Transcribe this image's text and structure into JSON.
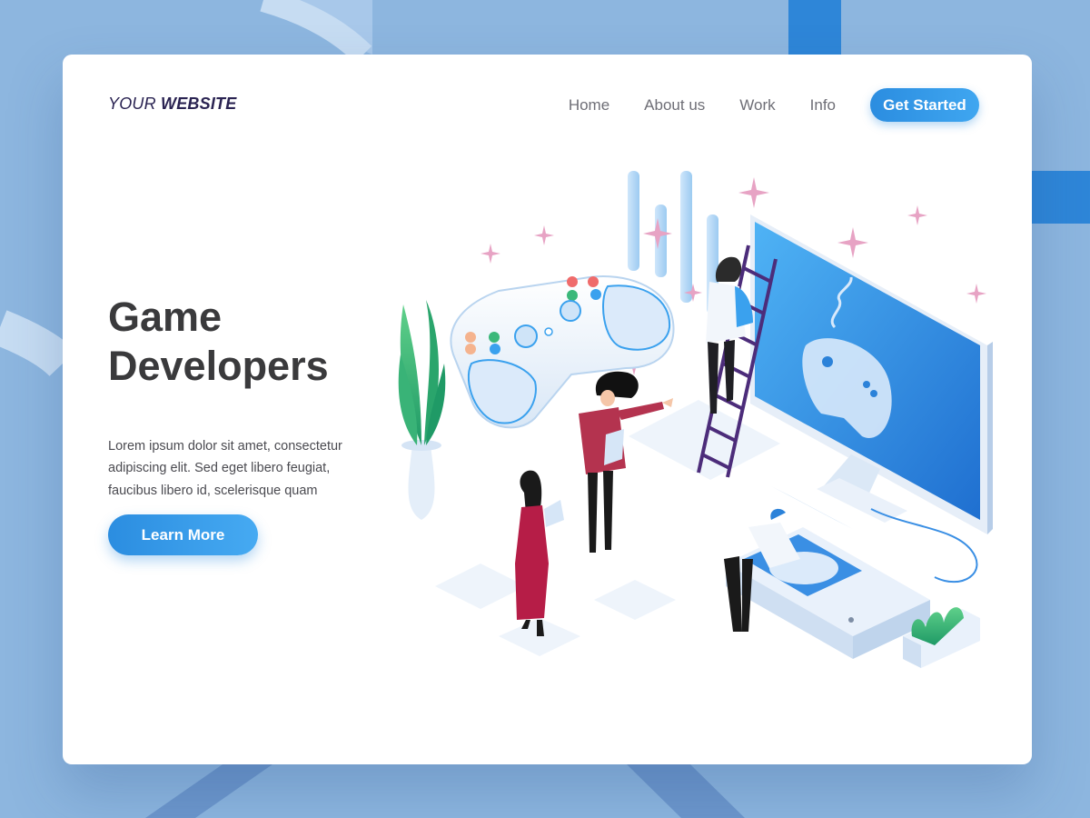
{
  "header": {
    "logo_prefix": "YOUR",
    "logo_bold": "WEBSITE",
    "nav": [
      {
        "label": "Home"
      },
      {
        "label": "About us"
      },
      {
        "label": "Work"
      },
      {
        "label": "Info"
      }
    ],
    "cta_label": "Get Started"
  },
  "hero": {
    "title_line1": "Game",
    "title_line2": "Developers",
    "description": "Lorem ipsum dolor sit amet, consectetur adipiscing elit. Sed eget libero feugiat, faucibus libero id, scelerisque quam",
    "button_label": "Learn More"
  },
  "colors": {
    "background": "#8db6df",
    "accent": "#2b8de0",
    "logo": "#2a2352",
    "title": "#3a3a3c"
  },
  "illustration": {
    "icons": [
      "gamepad-icon",
      "monitor-icon",
      "ladder-icon",
      "plant-icon",
      "console-icon",
      "sparkle-icon"
    ]
  }
}
